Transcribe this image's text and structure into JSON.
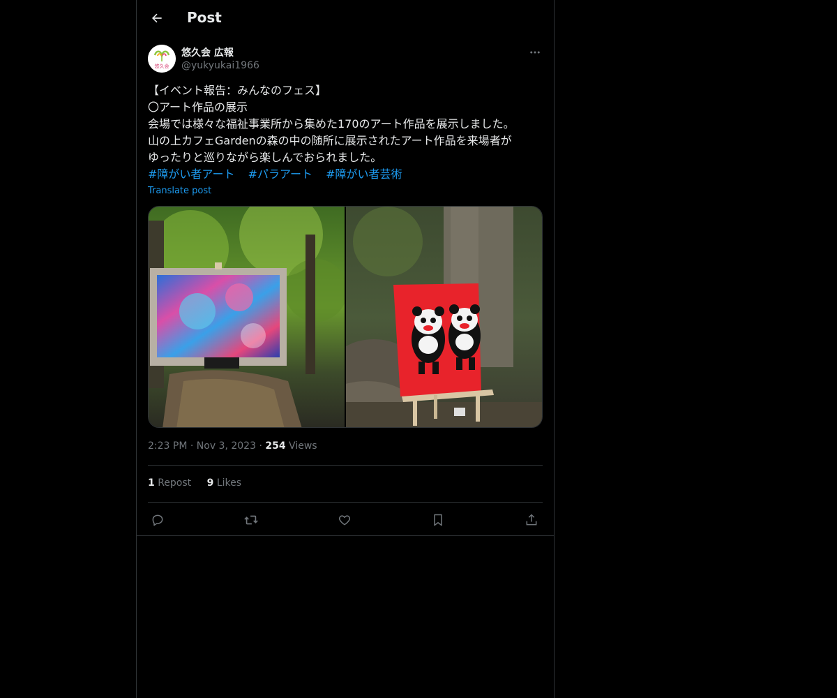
{
  "header": {
    "title": "Post",
    "back_icon": "arrow-left-icon"
  },
  "author": {
    "display_name": "悠久会 広報",
    "handle": "@yukyukai1966",
    "avatar_text": "悠久会",
    "more_icon": "more-horizontal-icon"
  },
  "post": {
    "lines": [
      "【イベント報告：みんなのフェス】",
      "〇アート作品の展示",
      "会場では様々な福祉事業所から集めた170のアート作品を展示しました。",
      "山の上カフェGardenの森の中の随所に展示されたアート作品を来場者が",
      "ゆったりと巡りながら楽しんでおられました。"
    ],
    "hashtags": [
      "#障がい者アート",
      "#パラアート",
      "#障がい者芸術"
    ],
    "translate_label": "Translate post"
  },
  "meta": {
    "time": "2:23 PM",
    "date": "Nov 3, 2023",
    "separator": "·",
    "views_count": "254",
    "views_label": "Views"
  },
  "engagement": {
    "reposts_count": "1",
    "reposts_label": "Repost",
    "likes_count": "9",
    "likes_label": "Likes"
  },
  "actions": [
    "reply-icon",
    "repost-icon",
    "like-icon",
    "bookmark-icon",
    "share-icon"
  ],
  "colors": {
    "background": "#000000",
    "text": "#e7e9ea",
    "secondary_text": "#71767b",
    "accent": "#1d9bf0",
    "border": "#2f3336"
  }
}
